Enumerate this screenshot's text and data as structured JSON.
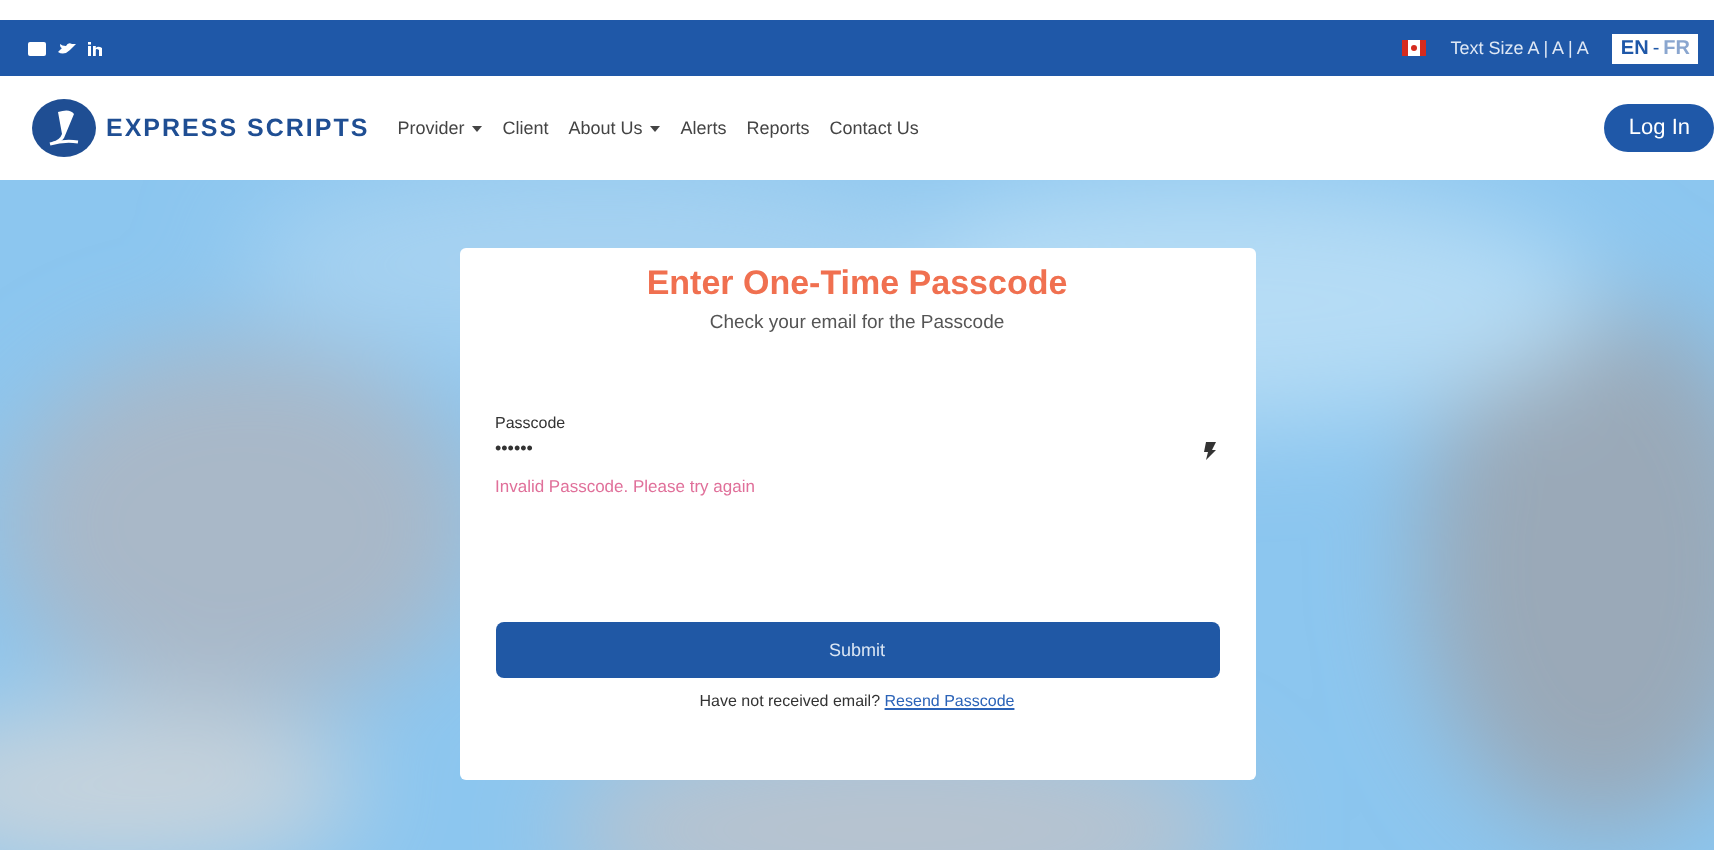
{
  "top_bar": {
    "social": [
      {
        "kind": "email"
      },
      {
        "kind": "twitter"
      },
      {
        "kind": "linkedin"
      }
    ],
    "text_size": "Text Size A | A | A",
    "languages": [
      {
        "label": "EN",
        "selected": true
      },
      {
        "label": "FR",
        "selected": false
      }
    ],
    "language_separator": "-"
  },
  "nav": {
    "logo": "EXPRESS SCRIPTS",
    "items": [
      {
        "label": "Provider",
        "dropdown": true
      },
      {
        "label": "Client",
        "dropdown": false
      },
      {
        "label": "About Us",
        "dropdown": true
      },
      {
        "label": "Alerts",
        "dropdown": false
      },
      {
        "label": "Reports",
        "dropdown": false
      },
      {
        "label": "Contact Us",
        "dropdown": false
      }
    ],
    "login": "Log In"
  },
  "card": {
    "title": "Enter One-Time Passcode",
    "subtitle": "Check your email for the Passcode",
    "field": {
      "label": "Passcode",
      "value": "••••••"
    },
    "error": "Invalid Passcode. Please try again",
    "submit": "Submit",
    "resend_prompt": "Have not received email?",
    "resend_link": "Resend Passcode"
  }
}
